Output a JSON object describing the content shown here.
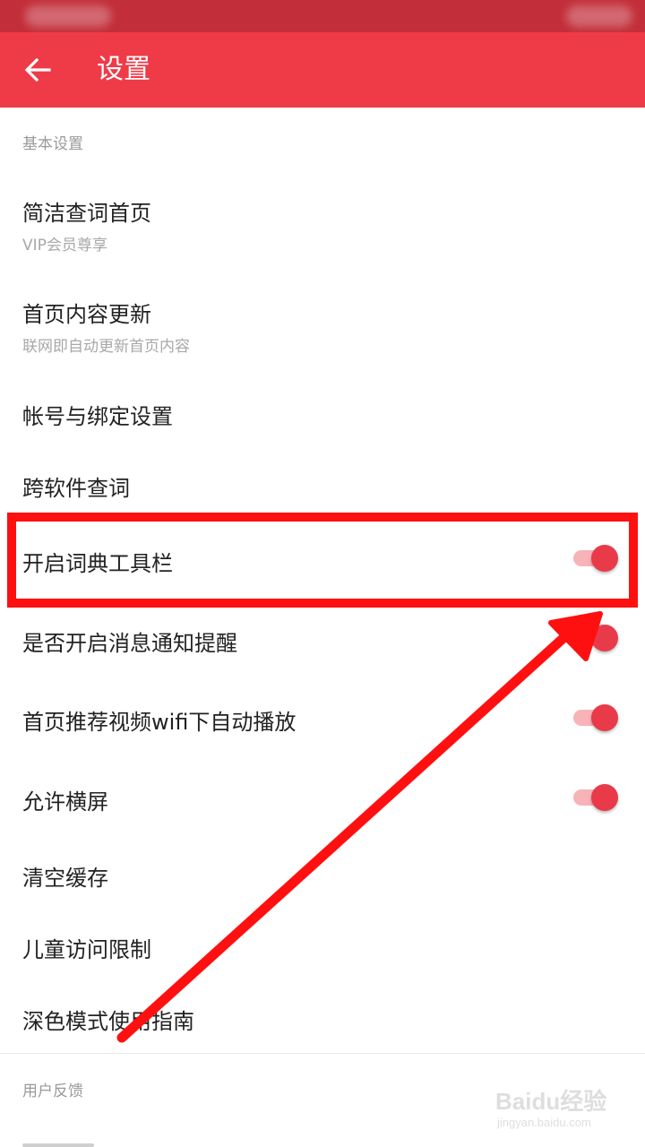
{
  "header": {
    "title": "设置",
    "back_icon": "arrow-left-icon",
    "background_color": "#ef3a48",
    "status_bar_color": "#c22e39"
  },
  "sections": {
    "basic": {
      "header": "基本设置"
    },
    "feedback": {
      "header": "用户反馈"
    }
  },
  "items": {
    "simple_lookup": {
      "title": "简洁查词首页",
      "subtitle": "VIP会员尊享"
    },
    "home_update": {
      "title": "首页内容更新",
      "subtitle": "联网即自动更新首页内容"
    },
    "account": {
      "title": "帐号与绑定设置"
    },
    "cross_app": {
      "title": "跨软件查词"
    },
    "dict_toolbar": {
      "title": "开启词典工具栏",
      "toggle_on": true
    },
    "notifications": {
      "title": "是否开启消息通知提醒",
      "toggle_on": true
    },
    "video_autoplay": {
      "title": "首页推荐视频wifi下自动播放",
      "toggle_on": true
    },
    "landscape": {
      "title": "允许横屏",
      "toggle_on": true
    },
    "clear_cache": {
      "title": "清空缓存"
    },
    "child_limit": {
      "title": "儿童访问限制"
    },
    "dark_mode": {
      "title": "深色模式使用指南"
    }
  },
  "toggle_colors": {
    "thumb": "#e93a4a",
    "track": "#f7b3b8"
  },
  "annotation": {
    "color": "#ff1010"
  },
  "watermark": {
    "brand": "Baidu经验",
    "url": "jingyan.baidu.com"
  }
}
